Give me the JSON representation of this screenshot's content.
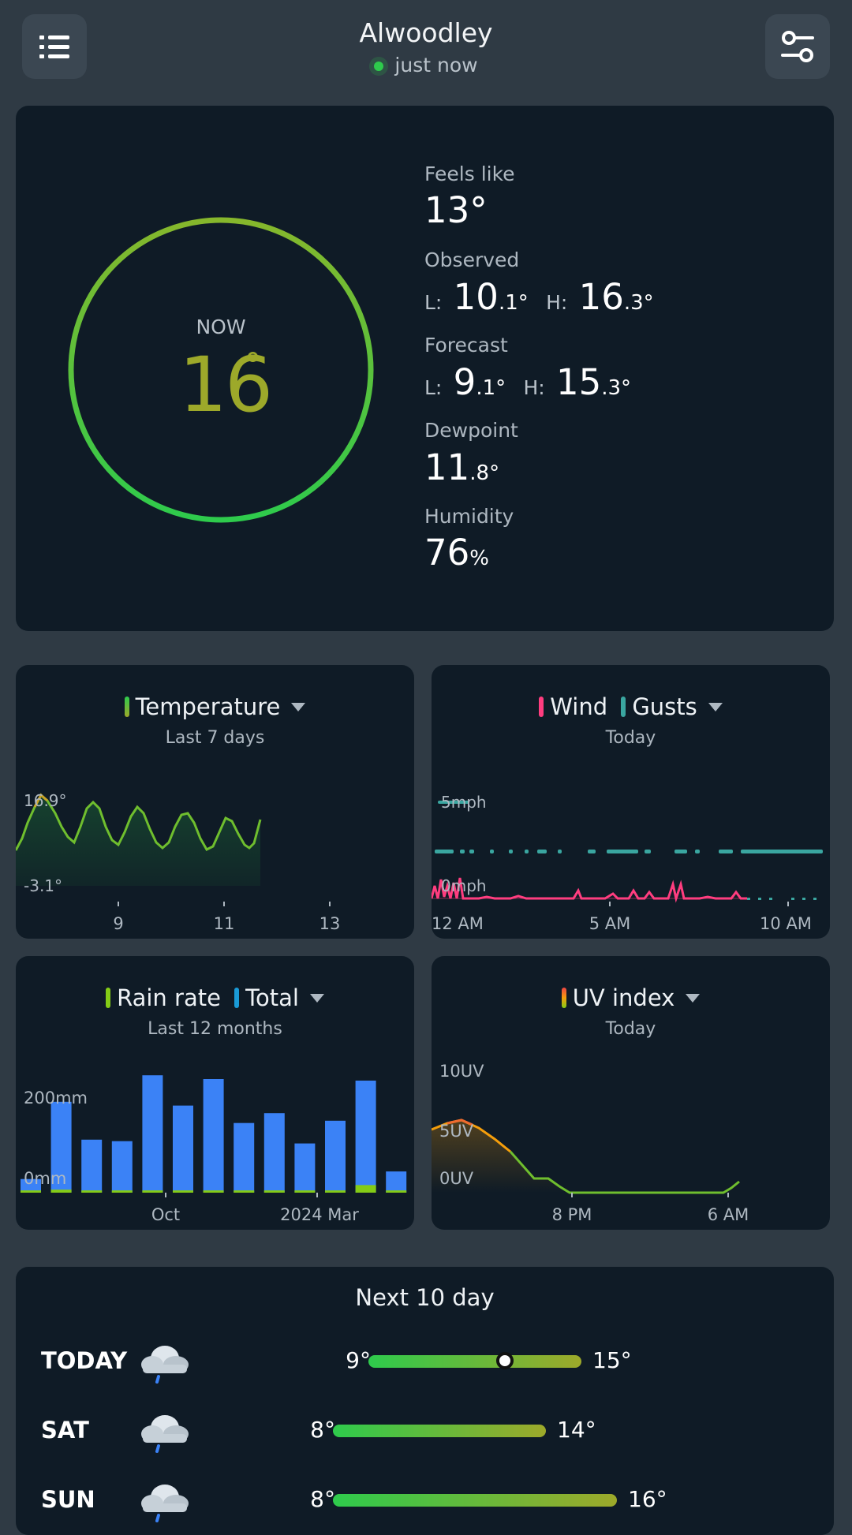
{
  "header": {
    "location": "Alwoodley",
    "updated": "just now",
    "menu_icon": "list-icon",
    "settings_icon": "sliders-icon"
  },
  "current": {
    "now_label": "NOW",
    "temp": "16",
    "deg": "°",
    "feels_like_label": "Feels like",
    "feels_like": "13°",
    "observed_label": "Observed",
    "observed_low": "10",
    "observed_low_dec": ".1°",
    "observed_high": "16",
    "observed_high_dec": ".3°",
    "forecast_label": "Forecast",
    "forecast_low": "9",
    "forecast_low_dec": ".1°",
    "forecast_high": "15",
    "forecast_high_dec": ".3°",
    "dewpoint_label": "Dewpoint",
    "dewpoint": "11",
    "dewpoint_dec": ".8°",
    "humidity_label": "Humidity",
    "humidity": "76",
    "humidity_unit": "%",
    "low_prefix": "L:",
    "high_prefix": "H:"
  },
  "temp_chart": {
    "title": "Temperature",
    "subtitle": "Last 7 days",
    "y_top": "16.9°",
    "y_bottom": "-3.1°",
    "x_ticks": [
      "9",
      "11",
      "13"
    ]
  },
  "wind_chart": {
    "title_wind": "Wind",
    "title_gusts": "Gusts",
    "subtitle": "Today",
    "y_top": "5mph",
    "y_bottom": "0mph",
    "x_ticks": [
      "12 AM",
      "5 AM",
      "10 AM"
    ]
  },
  "rain_chart": {
    "title_rate": "Rain rate",
    "title_total": "Total",
    "subtitle": "Last 12 months",
    "y_top": "200mm",
    "y_bottom": "0mm",
    "x_ticks": [
      "Oct",
      "2024 Mar"
    ],
    "totals": [
      18,
      120,
      70,
      68,
      155,
      115,
      150,
      92,
      105,
      65,
      95,
      148,
      28
    ],
    "rates": [
      0,
      4,
      0,
      0,
      0,
      0,
      0,
      0,
      0,
      0,
      0,
      10,
      0
    ]
  },
  "uv_chart": {
    "title": "UV index",
    "subtitle": "Today",
    "y_top": "10UV",
    "y_mid": "5UV",
    "y_bottom": "0UV",
    "x_ticks": [
      "8 PM",
      "6 AM"
    ]
  },
  "forecast": {
    "title": "Next 10 day",
    "days": [
      {
        "day": "TODAY",
        "lo": "9°",
        "hi": "15°"
      },
      {
        "day": "SAT",
        "lo": "8°",
        "hi": "14°"
      },
      {
        "day": "SUN",
        "lo": "8°",
        "hi": "16°"
      }
    ]
  },
  "colors": {
    "background": "#2f3a44",
    "card": "#0f1b26",
    "green": "#2ecb4c",
    "olive": "#9da92a",
    "wind": "#ff3d7f",
    "gusts": "#3aa6a0",
    "rain_total": "#3b82f6",
    "rain_rate": "#84cc16"
  }
}
